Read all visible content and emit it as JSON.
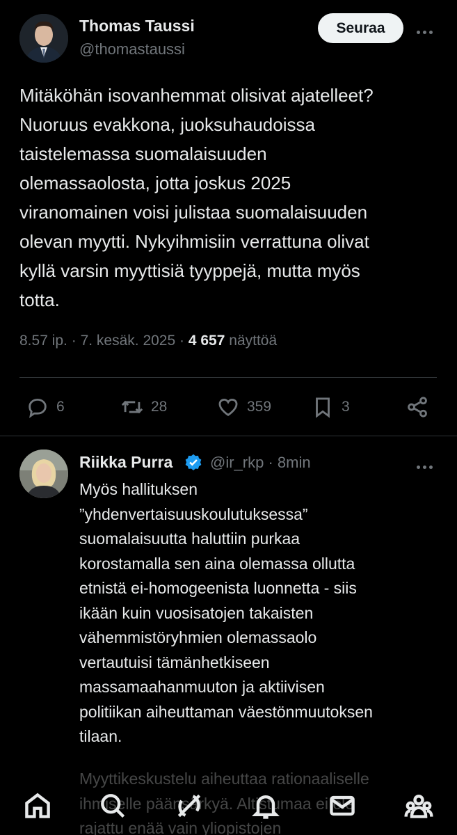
{
  "main_tweet": {
    "author_name": "Thomas Taussi",
    "author_handle": "@thomastaussi",
    "follow_label": "Seuraa",
    "text": "Mitäköhän isovanhemmat olisivat ajatelleet?\nNuoruus evakkona, juoksuhaudoissa\ntaistelemassa suomalaisuuden\nolemassaolosta, jotta joskus 2025\nviranomainen voisi julistaa suomalaisuuden\nolevan myytti. Nykyihmisiin verrattuna olivat\nkyllä varsin myyttisiä tyyppejä, mutta myös\ntotta.",
    "time": "8.57 ip.",
    "date": "7. kesäk. 2025",
    "views_count": "4 657",
    "views_label": "näyttöä",
    "separator": "·",
    "replies": "6",
    "reposts": "28",
    "likes": "359",
    "bookmarks": "3"
  },
  "reply": {
    "author_name": "Riikka Purra",
    "author_handle": "@ir_rkp",
    "time": "8min",
    "separator": "·",
    "text": "Myös hallituksen\n”yhdenvertaisuuskoulutuksessa”\nsuomalaisuutta haluttiin purkaa\nkorostamalla sen aina olemassa ollutta\netnistä ei-homogeenista luonnetta - siis\nikään kuin vuosisatojen takaisten\nvähemmistöryhmien olemassaolo\nvertautuisi tämänhetkiseen\nmassamaahanmuuton ja aktiivisen\npolitiikan aiheuttaman väestönmuutoksen\ntilaan.",
    "text_continued": "Myyttikeskustelu aiheuttaa rationaaliselle\nihmiselle päänsärkyä. Altistumaa ei ole\nrajattu enää vain yliopistojen"
  },
  "icons": {
    "reply": "reply-icon",
    "repost": "repost-icon",
    "like": "heart-icon",
    "bookmark": "bookmark-icon",
    "share": "share-icon",
    "more": "more-icon",
    "verified": "verified-badge-icon",
    "nav": [
      "home-icon",
      "search-icon",
      "grok-icon",
      "notifications-icon",
      "messages-icon",
      "communities-icon"
    ]
  },
  "colors": {
    "background": "#000000",
    "text": "#e7e9ea",
    "muted": "#71767b",
    "verified": "#1d9bf0",
    "follow_bg": "#eff3f4"
  }
}
